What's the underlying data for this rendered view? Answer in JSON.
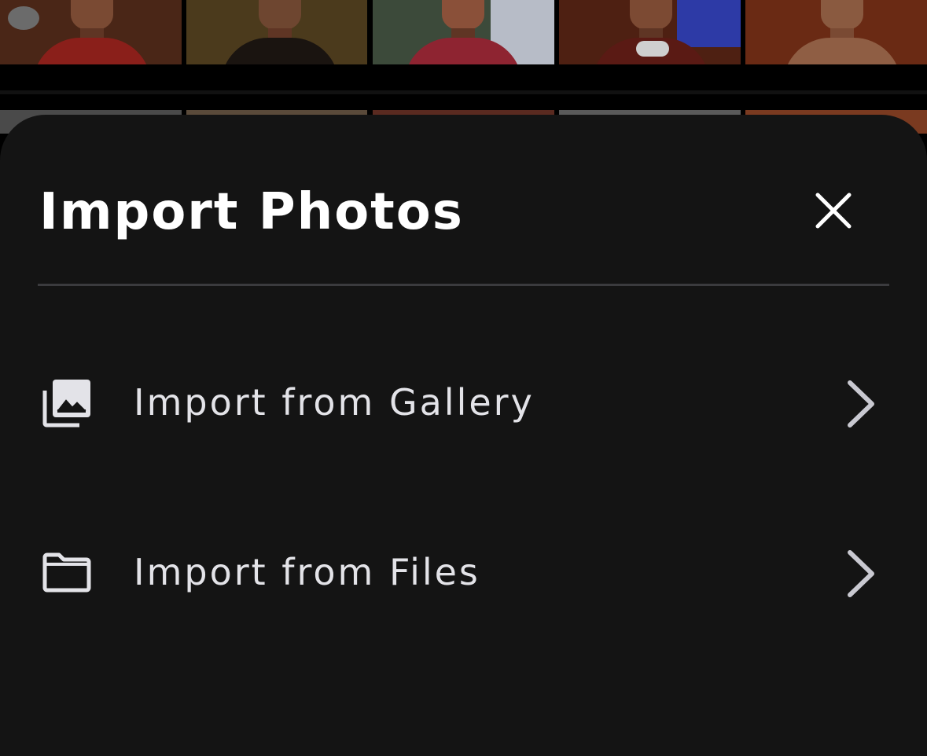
{
  "sheet": {
    "title": "Import Photos",
    "close_icon": "close-icon"
  },
  "options": [
    {
      "label": "Import from Gallery",
      "icon": "photo-library-icon",
      "chevron_icon": "chevron-right-icon"
    },
    {
      "label": "Import from Files",
      "icon": "folder-icon",
      "chevron_icon": "chevron-right-icon"
    }
  ],
  "colors": {
    "sheet_background": "#141414",
    "title_text": "#ffffff",
    "option_text": "#e3e3e8",
    "icon": "#e3e3e8",
    "chevron": "#c9c9d1",
    "divider": "#3b3b3e"
  }
}
